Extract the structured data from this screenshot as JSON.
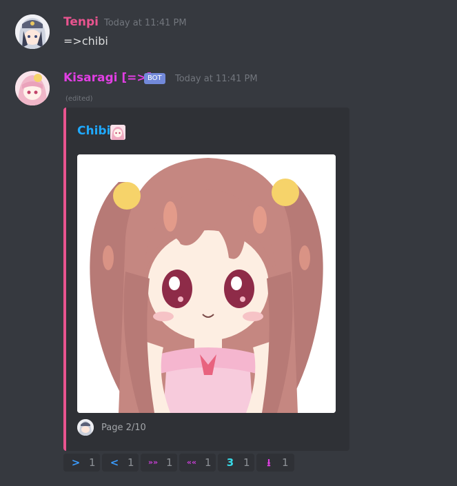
{
  "messages": [
    {
      "username": "Tenpi",
      "username_color": "#e9548f",
      "timestamp": "Today at 11:41 PM",
      "content": "=>chibi"
    },
    {
      "username": "Kisaragi [=>]",
      "username_color": "#e13fe3",
      "bot_tag": "BOT",
      "timestamp": "Today at 11:41 PM",
      "edited": "(edited)",
      "embed": {
        "title": "Chibi",
        "title_color": "#1fa9ff",
        "bar_color": "#e9548f",
        "footer": "Page 2/10"
      }
    }
  ],
  "reactions": [
    {
      "icon": "chevron-right-icon",
      "glyph": ">",
      "color": "#3b9cff",
      "count": "1"
    },
    {
      "icon": "chevron-left-icon",
      "glyph": "<",
      "color": "#3b9cff",
      "count": "1"
    },
    {
      "icon": "double-right-arrow-icon",
      "glyph": "»»",
      "color": "#c93ed6",
      "count": "1"
    },
    {
      "icon": "double-left-arrow-icon",
      "glyph": "««",
      "color": "#c93ed6",
      "count": "1"
    },
    {
      "icon": "number-three-icon",
      "glyph": "3",
      "color": "#38d9e6",
      "count": "1"
    },
    {
      "icon": "download-icon",
      "glyph": "⭳",
      "color": "#e13fe3",
      "count": "1"
    }
  ],
  "colors": {
    "background": "#36393f",
    "embed_background": "#2f3136",
    "timestamp": "#72767d",
    "bot_tag": "#7289da"
  }
}
